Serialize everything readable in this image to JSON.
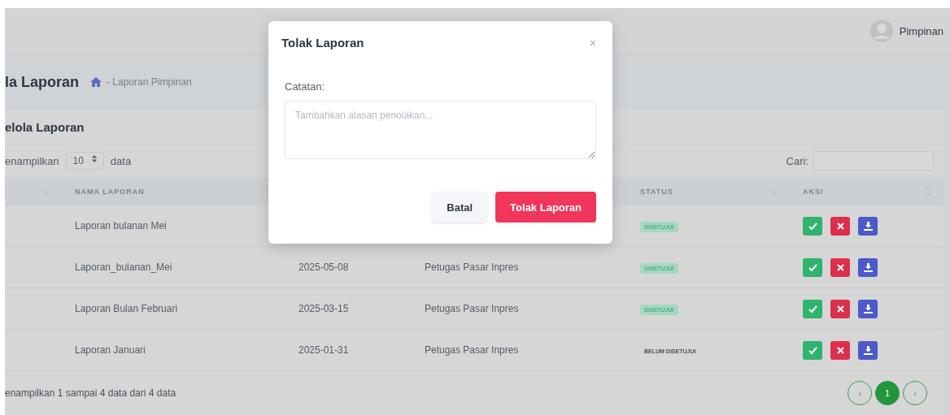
{
  "topbar": {
    "user": "Pimpinan"
  },
  "header": {
    "title": "la Laporan",
    "breadcrumb": "- Laporan Pimpinan"
  },
  "card": {
    "title": "elola Laporan",
    "length_prefix": "enampilkan",
    "length_value": "10",
    "length_suffix": "data",
    "search_label": "Cari:"
  },
  "table": {
    "columns": [
      {
        "label": "NAMA LAPORAN"
      },
      {
        "label": "STATUS"
      },
      {
        "label": "AKSI"
      }
    ],
    "rows": [
      {
        "name": "Laporan bulanan Mei",
        "status": "DISETUJUI",
        "kind": "badge"
      },
      {
        "name": "Laporan_bulanan_Mei",
        "date": "2025-05-08",
        "officer": "Petugas Pasar Inpres",
        "status": "DISETUJUI",
        "kind": "badge"
      },
      {
        "name": "Laporan Bulan Februari",
        "date": "2025-03-15",
        "officer": "Petugas Pasar Inpres",
        "status": "DISETUJUI",
        "kind": "badge"
      },
      {
        "name": "Laporan Januari",
        "date": "2025-01-31",
        "officer": "Petugas Pasar Inpres",
        "status": "BELUM DISETUJUI",
        "kind": "text"
      }
    ]
  },
  "footer": {
    "info": "enampilkan 1 sampai 4 data dari 4 data",
    "pages": [
      {
        "label": "‹",
        "selected": false
      },
      {
        "label": "1",
        "selected": true
      },
      {
        "label": "›",
        "selected": false
      }
    ]
  },
  "modal": {
    "title": "Tolak Laporan",
    "close": "×",
    "label": "Catatan:",
    "placeholder": "Tambahkan alasan penolakan...",
    "buttons": [
      {
        "label": "Batal",
        "kind": "secondary"
      },
      {
        "label": "Tolak Laporan",
        "kind": "danger"
      }
    ]
  }
}
